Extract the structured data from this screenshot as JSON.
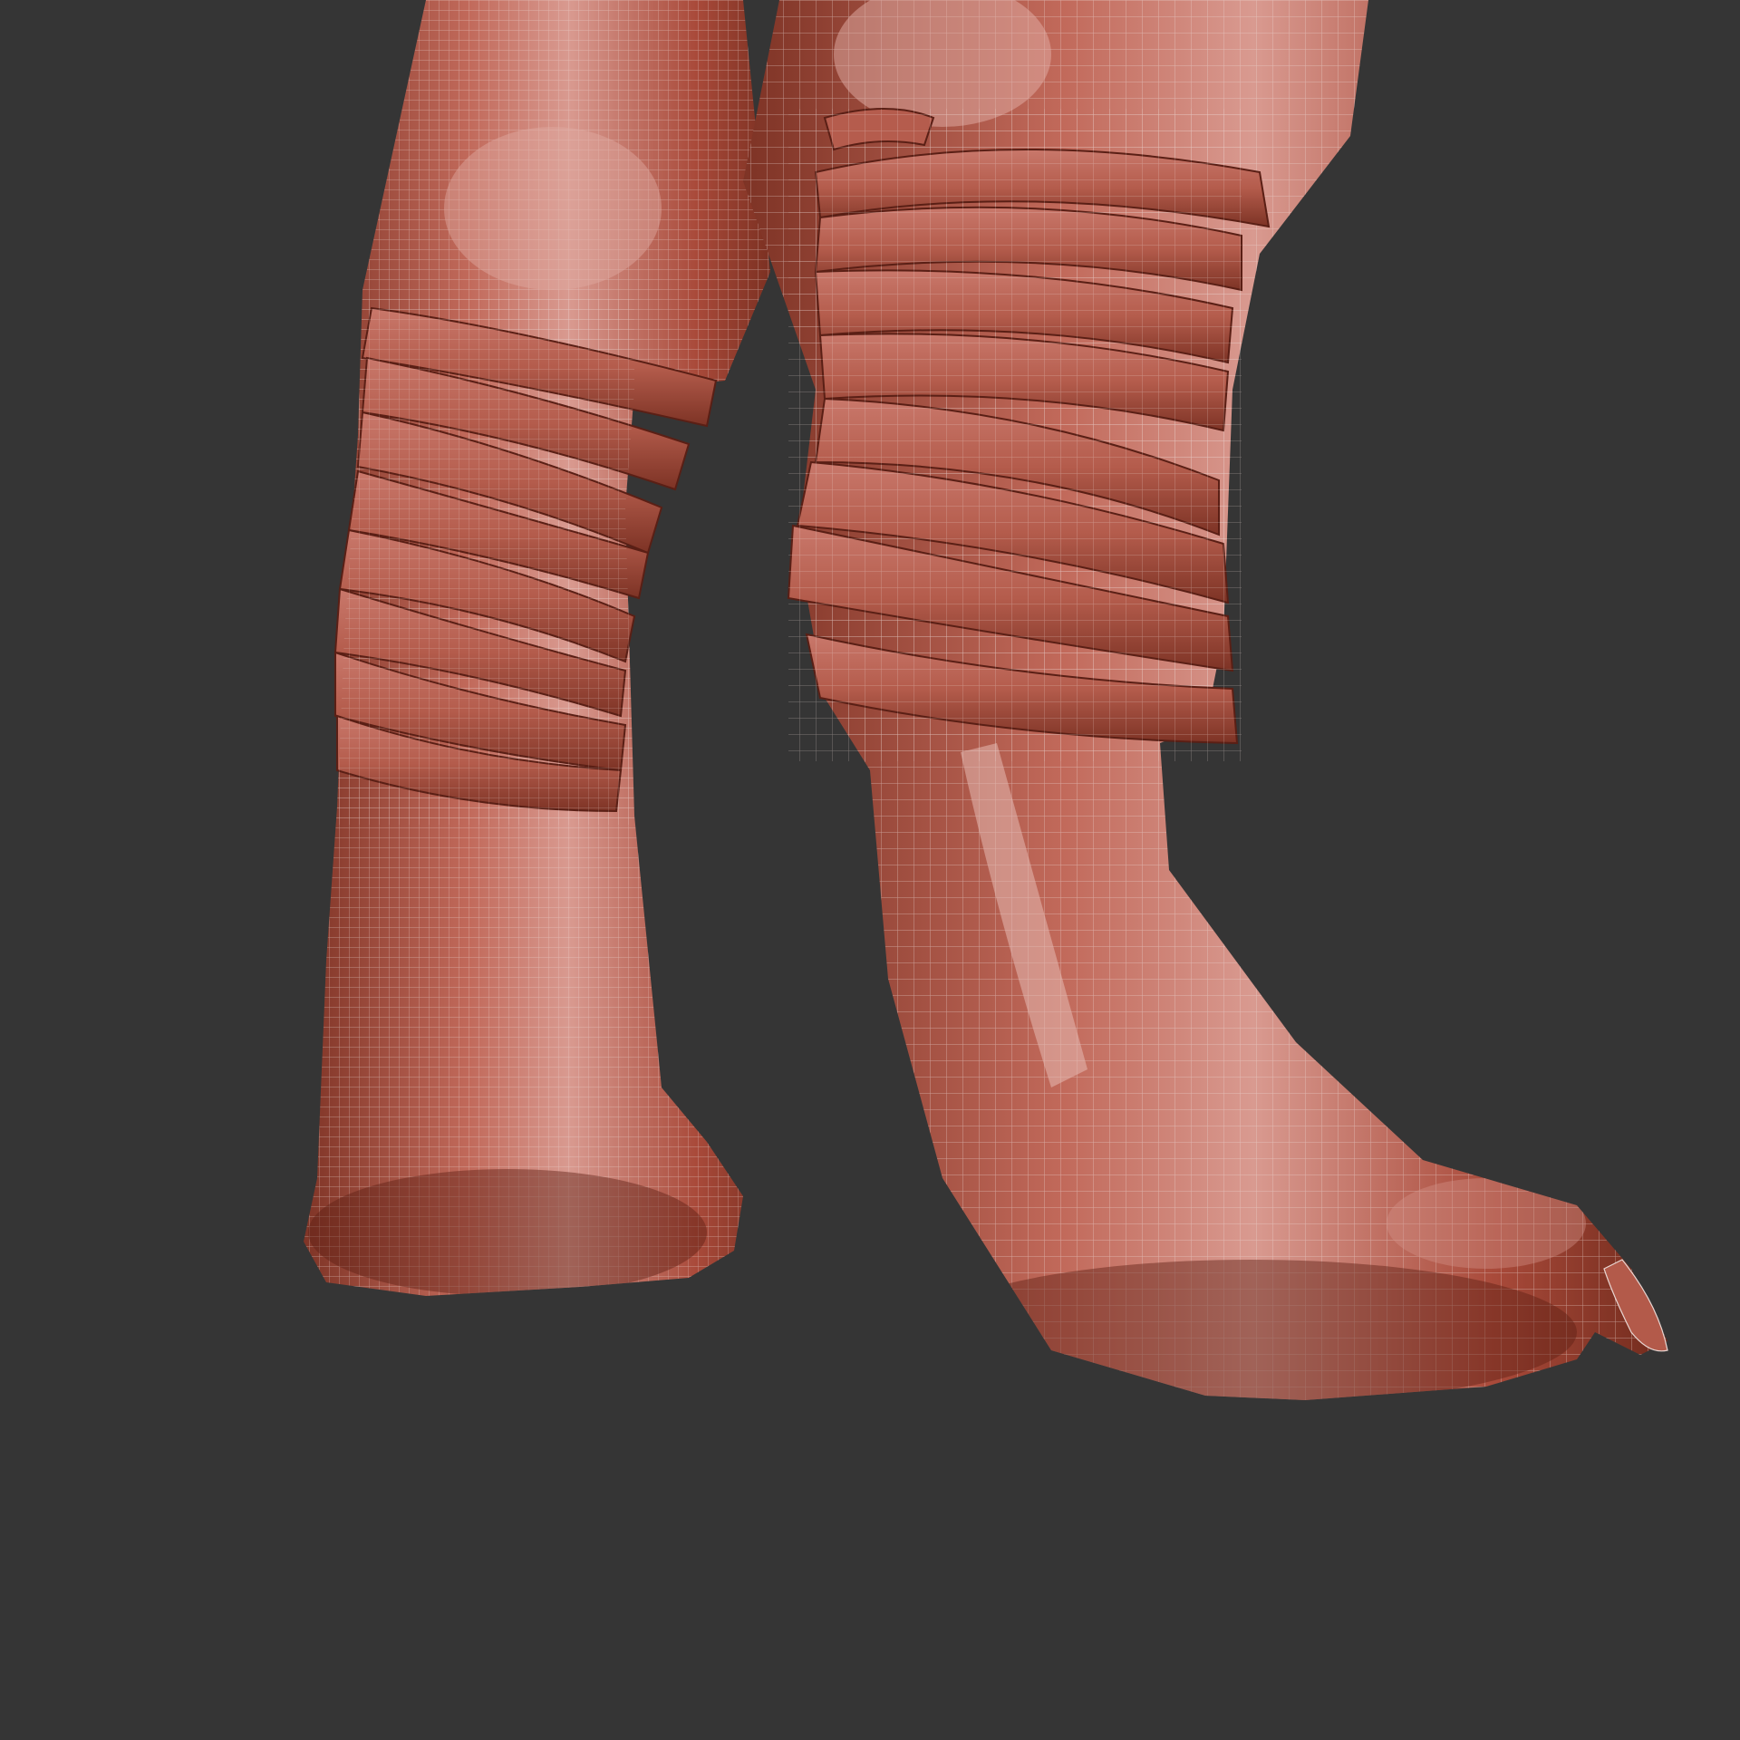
{
  "scene": {
    "subject_description": "",
    "background_color": "#353535",
    "mesh_base_color": "#b35a4a",
    "mesh_shadow_color": "#6e2a1e",
    "mesh_highlight_color": "#d4948a",
    "wireframe_color": "#e8d6d2"
  }
}
